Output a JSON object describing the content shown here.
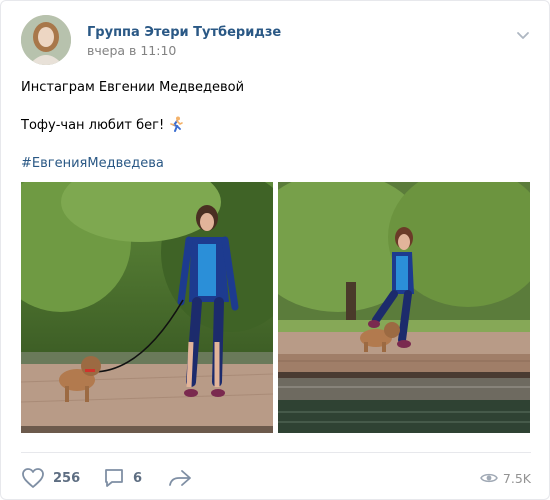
{
  "post": {
    "author": "Группа Этери Тутберидзе",
    "time": "вчера в 11:10",
    "text_line1": "Инстаграм Евгении Медведевой",
    "text_line2": "Тофу-чан любит бег!",
    "hashtag": "#ЕвгенияМедведева"
  },
  "footer": {
    "likes": "256",
    "comments": "6",
    "views": "7.5K"
  },
  "icons": {
    "more": "chevron-down-icon",
    "like": "heart-icon",
    "comment": "comment-icon",
    "share": "share-arrow-icon",
    "views": "eye-icon",
    "emoji": "runner-emoji-icon"
  },
  "colors": {
    "link": "#2a5885",
    "muted": "#828282",
    "action": "#5e6e82"
  }
}
